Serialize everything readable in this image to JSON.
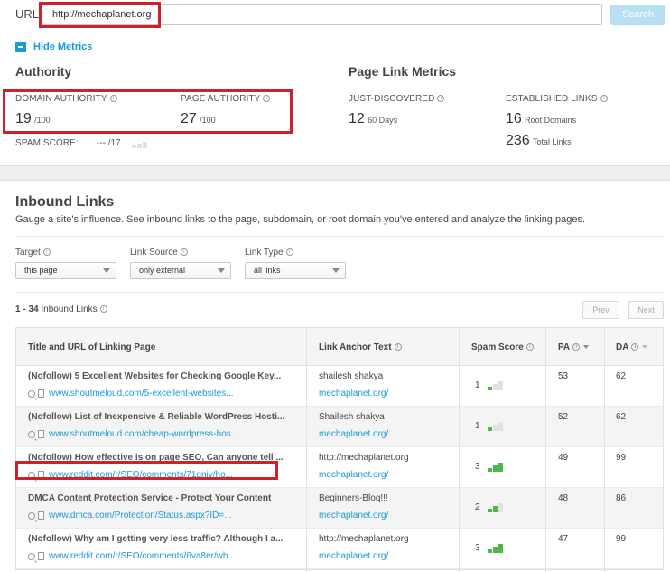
{
  "url_bar": {
    "label": "URL:",
    "value": "http://mechaplanet.org",
    "search_label": "Search"
  },
  "toggle": {
    "hide_metrics_label": "Hide Metrics"
  },
  "authority": {
    "heading": "Authority",
    "domain_authority": {
      "label": "DOMAIN AUTHORITY",
      "value": "19",
      "unit": "/100"
    },
    "page_authority": {
      "label": "PAGE AUTHORITY",
      "value": "27",
      "unit": "/100"
    },
    "spam_score": {
      "label": "SPAM SCORE:",
      "value": "--- /17"
    }
  },
  "page_link_metrics": {
    "heading": "Page Link Metrics",
    "just_discovered": {
      "label": "JUST-DISCOVERED",
      "value": "12",
      "unit": "60 Days"
    },
    "established": {
      "label": "ESTABLISHED LINKS",
      "root_domains": {
        "value": "16",
        "unit": "Root Domains"
      },
      "total_links": {
        "value": "236",
        "unit": "Total Links"
      }
    }
  },
  "inbound": {
    "title": "Inbound Links",
    "description": "Gauge a site's influence. See inbound links to the page, subdomain, or root domain you've entered and analyze the linking pages.",
    "filters": {
      "target": {
        "label": "Target",
        "value": "this page"
      },
      "link_source": {
        "label": "Link Source",
        "value": "only external"
      },
      "link_type": {
        "label": "Link Type",
        "value": "all links"
      }
    },
    "count_range": "1 - 34",
    "count_label": "Inbound Links",
    "prev_label": "Prev",
    "next_label": "Next",
    "columns": {
      "title_url": "Title and URL of Linking Page",
      "anchor": "Link Anchor Text",
      "spam": "Spam Score",
      "pa": "PA",
      "da": "DA"
    },
    "rows": [
      {
        "title": "(Nofollow) 5 Excellent Websites for Checking Google Key...",
        "url": "www.shoutmeloud.com/5-excellent-websites...",
        "anchor": "shailesh shakya",
        "anchor_url": "mechaplanet.org/",
        "spam": "1",
        "spam_level": 1,
        "pa": "53",
        "da": "62"
      },
      {
        "title": "(Nofollow) List of Inexpensive & Reliable WordPress Hosti...",
        "url": "www.shoutmeloud.com/cheap-wordpress-hos...",
        "anchor": "Shailesh shakya",
        "anchor_url": "mechaplanet.org/",
        "spam": "1",
        "spam_level": 1,
        "pa": "52",
        "da": "62"
      },
      {
        "title": "(Nofollow) How effective is on page SEO, Can anyone tell ...",
        "url": "www.reddit.com/r/SEO/comments/71qnjv/ho...",
        "anchor": "http://mechaplanet.org",
        "anchor_url": "mechaplanet.org/",
        "spam": "3",
        "spam_level": 3,
        "pa": "49",
        "da": "99"
      },
      {
        "title": "DMCA Content Protection Service - Protect Your Content",
        "url": "www.dmca.com/Protection/Status.aspx?ID=...",
        "anchor": "Beginners-Blog!!!",
        "anchor_url": "mechaplanet.org/",
        "spam": "2",
        "spam_level": 2,
        "pa": "48",
        "da": "86"
      },
      {
        "title": "(Nofollow) Why am I getting very less traffic? Although I a...",
        "url": "www.reddit.com/r/SEO/comments/6va8er/wh...",
        "anchor": "http://mechaplanet.org",
        "anchor_url": "mechaplanet.org/",
        "spam": "3",
        "spam_level": 3,
        "pa": "47",
        "da": "99"
      }
    ]
  },
  "colors": {
    "accent": "#1a9bd8",
    "highlight_red": "#d0202a",
    "spam_green": "#4cb848",
    "search_button": "#b9dff3"
  },
  "icons": [
    "minus-square-icon",
    "info-icon",
    "magnifier-icon",
    "page-icon",
    "sort-desc-icon",
    "dropdown-caret-icon"
  ]
}
